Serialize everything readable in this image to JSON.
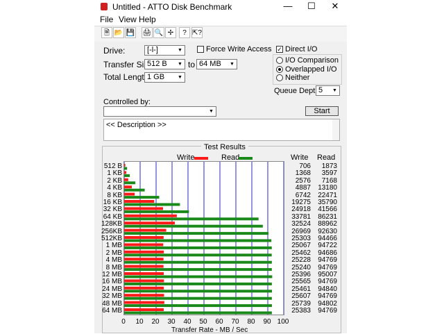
{
  "window": {
    "title": "Untitled - ATTO Disk Benchmark"
  },
  "menu": [
    "File",
    "View",
    "Help"
  ],
  "toolbar": {
    "icons": [
      "new-file-icon",
      "open-folder-icon",
      "save-icon",
      "print-icon",
      "print-preview-icon",
      "move-icon",
      "info-icon",
      "context-help-icon"
    ]
  },
  "form": {
    "drive_label": "Drive:",
    "drive_value": "[-l-]",
    "force_write_label": "Force Write Access",
    "force_write_checked": false,
    "direct_io_label": "Direct I/O",
    "direct_io_checked": true,
    "transfer_size_label": "Transfer Size:",
    "transfer_from": "512 B",
    "to_label": "to",
    "transfer_to": "64 MB",
    "total_length_label": "Total Length:",
    "total_length": "1 GB",
    "io_options": [
      "I/O Comparison",
      "Overlapped I/O",
      "Neither"
    ],
    "io_selected": 1,
    "queue_depth_label": "Queue Depth:",
    "queue_depth": "5",
    "controlled_by_label": "Controlled by:",
    "controlled_by": "",
    "start_label": "Start",
    "description": "<< Description >>"
  },
  "results": {
    "title": "Test Results",
    "legend_write": "Write",
    "legend_read": "Read",
    "col_write": "Write",
    "col_read": "Read",
    "xlabel": "Transfer Rate - MB / Sec",
    "colors": {
      "write": "#ff1a1a",
      "read": "#198a19",
      "grid": "#2a2ac8"
    }
  },
  "chart_data": {
    "type": "bar",
    "categories": [
      "512 B",
      "1 KB",
      "2 KB",
      "4 KB",
      "8 KB",
      "16 KB",
      "32 KB",
      "64 KB",
      "128KB",
      "256KB",
      "512KB",
      "1 MB",
      "2 MB",
      "4 MB",
      "8 MB",
      "12 MB",
      "16 MB",
      "24 MB",
      "32 MB",
      "48 MB",
      "64 MB"
    ],
    "series": [
      {
        "name": "Write",
        "values": [
          706,
          1368,
          2576,
          4887,
          6742,
          19275,
          24918,
          33781,
          32524,
          26969,
          25303,
          25067,
          25462,
          25228,
          25240,
          25396,
          25565,
          25461,
          25607,
          25739,
          25383
        ]
      },
      {
        "name": "Read",
        "values": [
          1873,
          3597,
          7168,
          13180,
          22471,
          35790,
          41566,
          86231,
          88962,
          92630,
          94466,
          94722,
          94686,
          94769,
          94769,
          95007,
          94769,
          94840,
          94769,
          94802,
          94769
        ]
      }
    ],
    "xlabel": "Transfer Rate - MB / Sec",
    "xticks": [
      0,
      10,
      20,
      30,
      40,
      50,
      60,
      70,
      80,
      90,
      100
    ],
    "xlim": [
      0,
      100
    ],
    "grid": true
  }
}
